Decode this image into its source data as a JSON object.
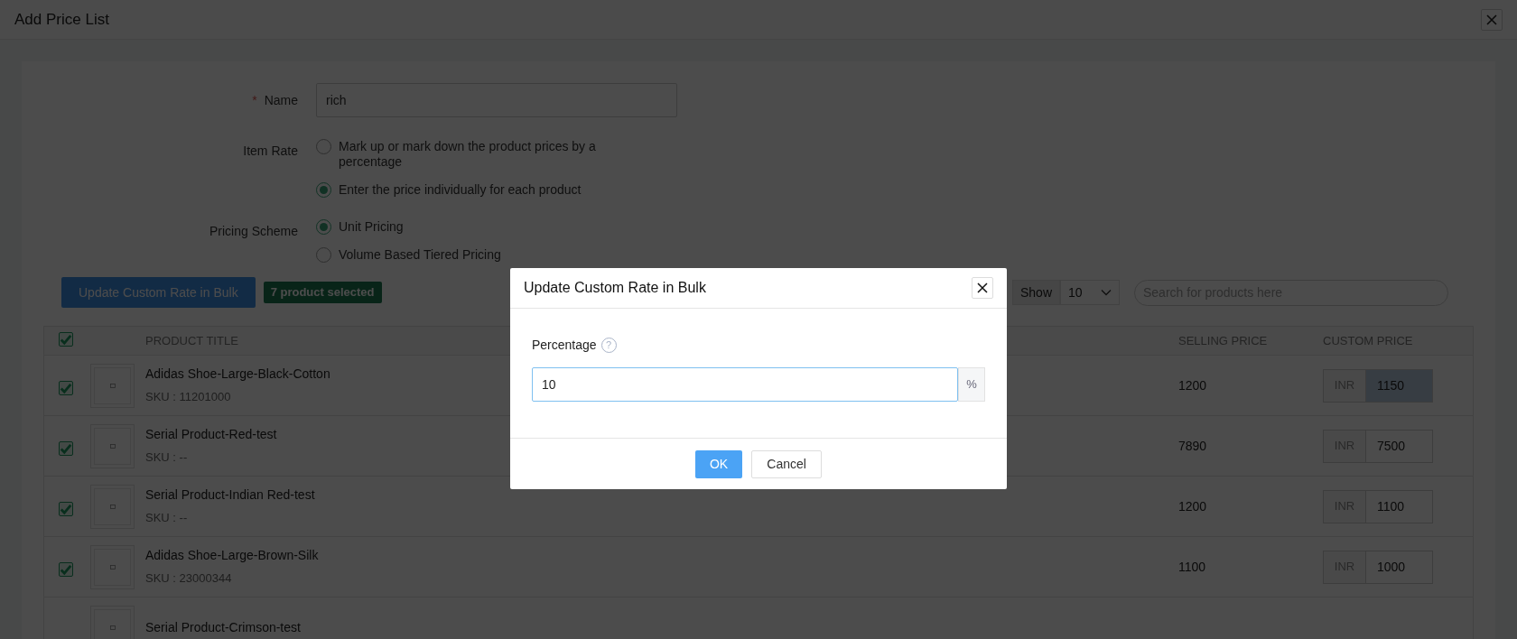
{
  "window": {
    "title": "Add Price List"
  },
  "form": {
    "name": {
      "label": "Name",
      "required_mark": "*",
      "value": "rich"
    },
    "item_rate": {
      "label": "Item Rate",
      "options": [
        {
          "label": "Mark up or mark down the product prices by a percentage",
          "selected": false
        },
        {
          "label": "Enter the price individually for each product",
          "selected": true
        }
      ]
    },
    "pricing_scheme": {
      "label": "Pricing Scheme",
      "options": [
        {
          "label": "Unit Pricing",
          "selected": true
        },
        {
          "label": "Volume Based Tiered Pricing",
          "selected": false
        }
      ]
    }
  },
  "toolbar": {
    "bulk_button": "Update Custom Rate in Bulk",
    "selection_badge": "7 product selected",
    "show_label": "Show",
    "page_size": "10",
    "search": {
      "placeholder": "Search for products here"
    }
  },
  "table": {
    "header_checked": true,
    "columns": [
      "PRODUCT TITLE",
      "SELLING PRICE",
      "CUSTOM PRICE"
    ],
    "rows": [
      {
        "checked": true,
        "title": "Adidas Shoe-Large-Black-Cotton",
        "sku": "SKU : 11201000",
        "selling_price": "1200",
        "currency": "INR",
        "custom_price": "1150",
        "highlighted": true
      },
      {
        "checked": true,
        "title": "Serial Product-Red-test",
        "sku": "SKU : --",
        "selling_price": "7890",
        "currency": "INR",
        "custom_price": "7500",
        "highlighted": false
      },
      {
        "checked": true,
        "title": "Serial Product-Indian Red-test",
        "sku": "SKU : --",
        "selling_price": "1200",
        "currency": "INR",
        "custom_price": "1100",
        "highlighted": false
      },
      {
        "checked": true,
        "title": "Adidas Shoe-Large-Brown-Silk",
        "sku": "SKU : 23000344",
        "selling_price": "1100",
        "currency": "INR",
        "custom_price": "1000",
        "highlighted": false
      },
      {
        "title": "Serial Product-Crimson-test"
      }
    ]
  },
  "dialog": {
    "title": "Update Custom Rate in Bulk",
    "field": {
      "label": "Percentage",
      "help": "?",
      "value": "10",
      "suffix": "%"
    },
    "buttons": [
      {
        "label": "OK",
        "kind": "primary"
      },
      {
        "label": "Cancel",
        "kind": "secondary"
      }
    ]
  }
}
